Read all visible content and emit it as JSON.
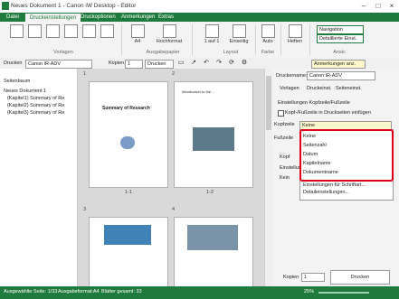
{
  "window": {
    "title": "Neues Dokument 1 - Canon iW Desktop - Editor"
  },
  "tabs": [
    "Datei",
    "Druckeinstellungen",
    "Druckoptionen",
    "Anmerkungen",
    "Extras"
  ],
  "ribbon": {
    "zoom_value": "A4",
    "orientation": "Hochformat",
    "pages_per_sheet": "1 auf 1",
    "one_sided": "Einseitig",
    "color": "Auto",
    "staple": "Heften",
    "navigation": "Navigation",
    "detailed": "Detaillierte Einst.",
    "groups": [
      "Vorlagen",
      "Ausgabepapier",
      "Layout",
      "Farbe",
      "Ansic"
    ]
  },
  "toolbar": {
    "printer_label": "Drucken",
    "printer_value": "Canon iR-ADV",
    "copies_label": "Kopien",
    "copies_value": "1",
    "print_button": "Drucken",
    "annotations_button": "Anmerkungen anz."
  },
  "leftpane": {
    "title": "Seitenbaum",
    "items": [
      "Neues Dokument 1",
      "(Kapitel1) Summary of Re",
      "(Kapitel2) Summary of Re",
      "(Kapitel3) Summary of Re"
    ]
  },
  "preview": {
    "pages": [
      {
        "num": "1",
        "heading": "Summary of Research",
        "caption": "1-1"
      },
      {
        "num": "2",
        "heading": "Introduction to the ...",
        "caption": "1-2"
      },
      {
        "num": "3",
        "heading": "",
        "caption": ""
      },
      {
        "num": "4",
        "heading": "",
        "caption": ""
      }
    ]
  },
  "rightpane": {
    "printer_label": "Druckername:",
    "printer_value": "Canon iR-ADV",
    "tabs": [
      "Vorlagen",
      "Druckeinst.",
      "Seiteneinst."
    ],
    "header_footer_title": "Einstellungen Kopfzeile/Fußzeile",
    "checkbox_label": "Kopf-/Fußzeile in Druckseiten einfügen",
    "header_label": "Kopfzeile",
    "header_value": "Keine",
    "footer_label": "Fußzeile",
    "other_labels": [
      "Kopf",
      "Einstellun",
      "Kein"
    ],
    "copies_label": "Kopien",
    "copies_value": "1",
    "print_button": "Drucken"
  },
  "dropdown": {
    "options": [
      "Keine",
      "Seitenzahl",
      "Datum",
      "Kapitelname",
      "Dokumentname"
    ],
    "extras": [
      "Einstellungen für Schriftart...",
      "Detaileinstellungen..."
    ]
  },
  "status": {
    "selected": "Ausgewählte Seite: 1/33",
    "format": "Ausgabeformat:A4",
    "sheets": "Blätter gesamt: 33",
    "zoom": "25%"
  }
}
